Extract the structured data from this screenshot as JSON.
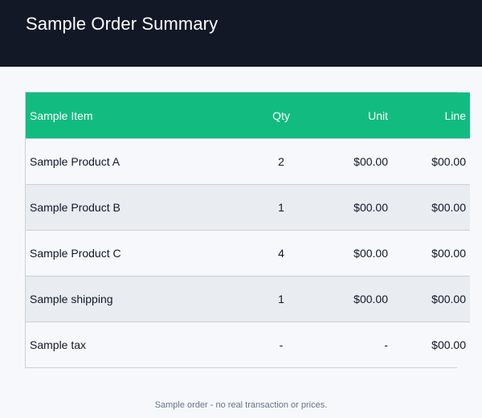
{
  "header": {
    "title": "Sample Order Summary"
  },
  "table": {
    "columns": [
      "Sample Item",
      "Qty",
      "Unit",
      "Line"
    ],
    "rows": [
      {
        "item": "Sample Product A",
        "qty": "2",
        "unit": "$00.00",
        "line": "$00.00"
      },
      {
        "item": "Sample Product B",
        "qty": "1",
        "unit": "$00.00",
        "line": "$00.00"
      },
      {
        "item": "Sample Product C",
        "qty": "4",
        "unit": "$00.00",
        "line": "$00.00"
      },
      {
        "item": "Sample shipping",
        "qty": "1",
        "unit": "$00.00",
        "line": "$00.00"
      },
      {
        "item": "Sample tax",
        "qty": "-",
        "unit": "-",
        "line": "$00.00"
      }
    ]
  },
  "footer": {
    "note": "Sample order - no real transaction or prices."
  },
  "colors": {
    "header_bg": "#121826",
    "table_header_bg": "#12BC80",
    "row_alt_bg": "#E9ECF0",
    "page_bg": "#F6F8FB"
  }
}
